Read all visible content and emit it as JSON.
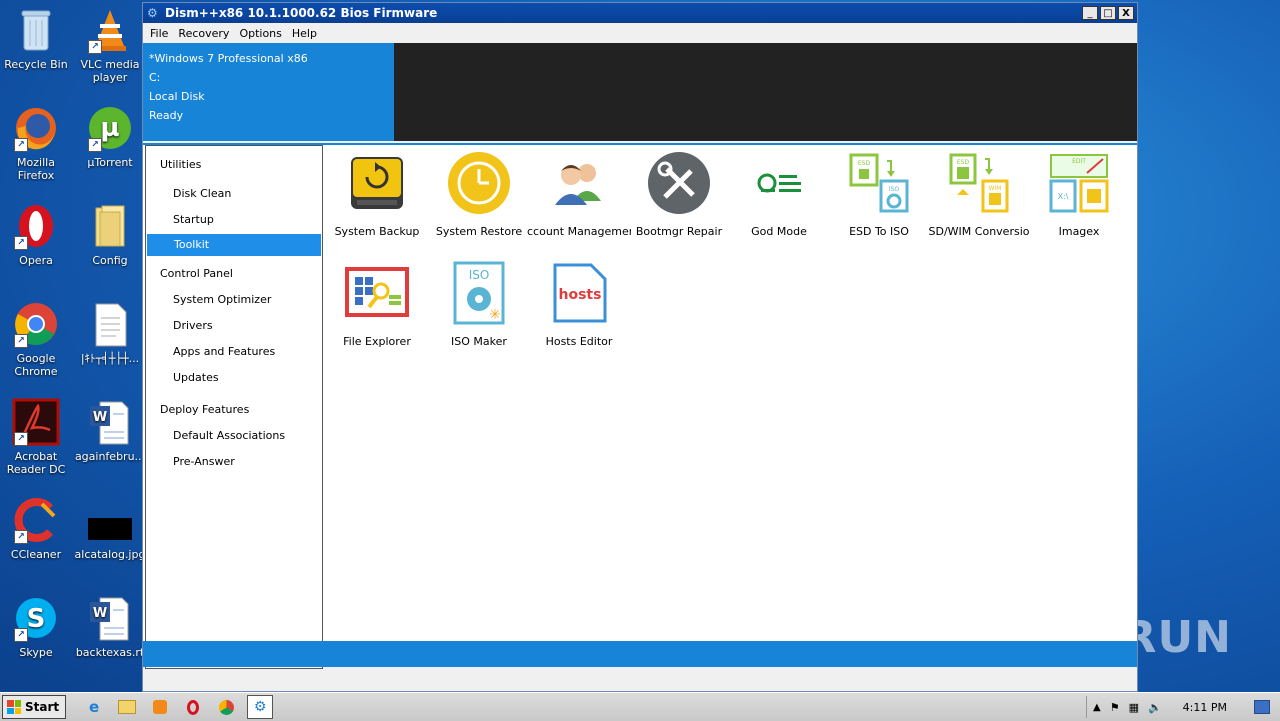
{
  "desktop": {
    "icons": [
      {
        "label": "Recycle Bin"
      },
      {
        "label": "VLC media player"
      },
      {
        "label": "Mozilla Firefox"
      },
      {
        "label": "µTorrent"
      },
      {
        "label": "Opera"
      },
      {
        "label": "Config"
      },
      {
        "label": "Google Chrome"
      },
      {
        "label": "|ｷﾄ┬╡┼├┼..."
      },
      {
        "label": "Acrobat Reader DC"
      },
      {
        "label": "againfebru..."
      },
      {
        "label": "CCleaner"
      },
      {
        "label": "alcatalog.jpg"
      },
      {
        "label": "Skype"
      },
      {
        "label": "backtexas.rt"
      }
    ],
    "watermark": "ANY RUN"
  },
  "window": {
    "title": "Dism++x86 10.1.1000.62 Bios Firmware",
    "controls": {
      "minimize": "_",
      "maximize": "□",
      "close": "X"
    },
    "menu": [
      "File",
      "Recovery",
      "Options",
      "Help"
    ],
    "info": {
      "os": "*Windows 7 Professional x86",
      "drive": "C:",
      "volume": "Local Disk",
      "status": "Ready"
    },
    "sidebar": {
      "utilities": {
        "label": "Utilities",
        "items": [
          "Disk Clean",
          "Startup",
          "Toolkit"
        ]
      },
      "control_panel": {
        "label": "Control Panel",
        "items": [
          "System Optimizer",
          "Drivers",
          "Apps and Features",
          "Updates"
        ]
      },
      "deploy": {
        "label": "Deploy Features",
        "items": [
          "Default Associations",
          "Pre-Answer"
        ]
      }
    },
    "tools": [
      {
        "label": "System Backup"
      },
      {
        "label": "System Restore"
      },
      {
        "label": "ccount Managemer"
      },
      {
        "label": "Bootmgr Repair"
      },
      {
        "label": "God Mode"
      },
      {
        "label": "ESD To ISO"
      },
      {
        "label": "SD/WIM Conversio"
      },
      {
        "label": "Imagex"
      },
      {
        "label": "File Explorer"
      },
      {
        "label": "ISO Maker"
      },
      {
        "label": "Hosts Editor"
      }
    ],
    "icon_texts": {
      "esd": "ESD",
      "iso": "ISO",
      "wim": "WIM",
      "edit": "EDIT",
      "xa": "X:\\",
      "hosts": "hosts"
    }
  },
  "taskbar": {
    "start": "Start",
    "clock": "4:11 PM"
  },
  "colors": {
    "accent": "#1884d8",
    "selected": "#1e8ee8",
    "dark_panel": "#222222"
  }
}
